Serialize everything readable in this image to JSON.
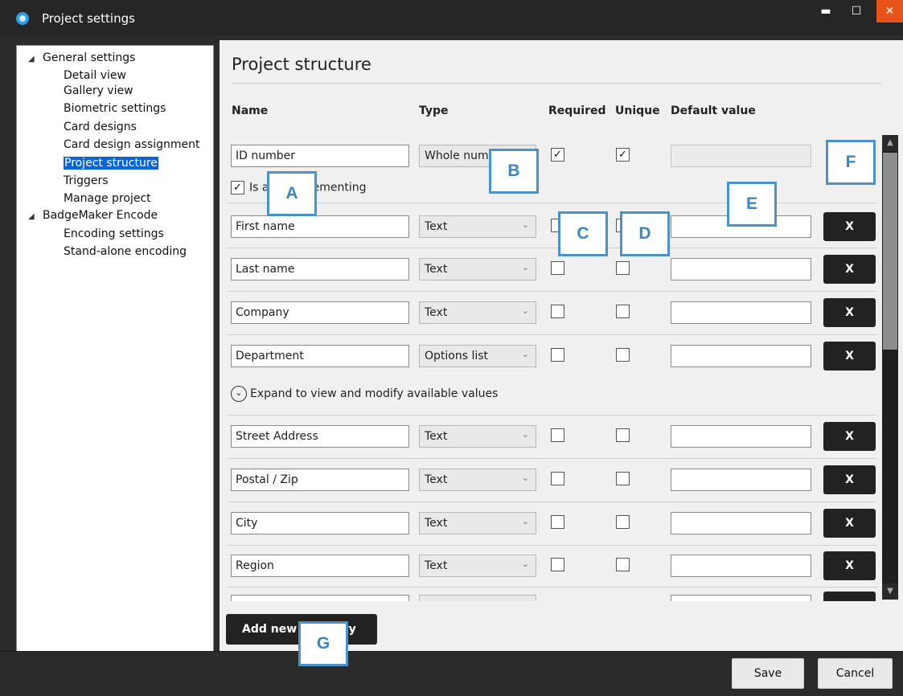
{
  "window": {
    "title": "Project settings",
    "minimize": "▬",
    "maximize": "☐",
    "close": "✕"
  },
  "sidebar": {
    "groups": [
      {
        "label": "General settings",
        "children": [
          "Detail view",
          "Gallery view",
          "Biometric settings",
          "Card designs",
          "Card design assignment",
          "Project structure",
          "Triggers",
          "Manage project"
        ]
      },
      {
        "label": "BadgeMaker Encode",
        "children": [
          "Encoding settings",
          "Stand-alone encoding"
        ]
      }
    ],
    "selected": "Project structure",
    "expanded_glyph": "◢"
  },
  "main": {
    "title": "Project structure",
    "columns": {
      "name": "Name",
      "type": "Type",
      "required": "Required",
      "unique": "Unique",
      "default_value": "Default value"
    },
    "rows": [
      {
        "name": "ID number",
        "type": "Whole number",
        "required": true,
        "unique": true,
        "default": "",
        "default_disabled": true,
        "type_select": false
      },
      {
        "name": "First name",
        "type": "Text",
        "required": false,
        "unique": false,
        "default": ""
      },
      {
        "name": "Last name",
        "type": "Text",
        "required": false,
        "unique": false,
        "default": ""
      },
      {
        "name": "Company",
        "type": "Text",
        "required": false,
        "unique": false,
        "default": ""
      },
      {
        "name": "Department",
        "type": "Options list",
        "required": false,
        "unique": false,
        "default": "",
        "default_select": true
      },
      {
        "name": "Street Address",
        "type": "Text",
        "required": false,
        "unique": false,
        "default": ""
      },
      {
        "name": "Postal / Zip",
        "type": "Text",
        "required": false,
        "unique": false,
        "default": ""
      },
      {
        "name": "City",
        "type": "Text",
        "required": false,
        "unique": false,
        "default": ""
      },
      {
        "name": "Region",
        "type": "Text",
        "required": false,
        "unique": false,
        "default": ""
      }
    ],
    "auto_increment_label": "Is auto-incrementing",
    "auto_increment_checked": true,
    "expand_label": "Expand to view and modify available values",
    "delete_label": "X",
    "add_button": "Add new property"
  },
  "footer": {
    "save": "Save",
    "cancel": "Cancel"
  },
  "callouts": [
    "A",
    "B",
    "C",
    "D",
    "E",
    "F",
    "G"
  ],
  "colors": {
    "accent": "#4a93c9",
    "selected": "#0a64d8",
    "close": "#e8531c",
    "dark": "#222222"
  }
}
